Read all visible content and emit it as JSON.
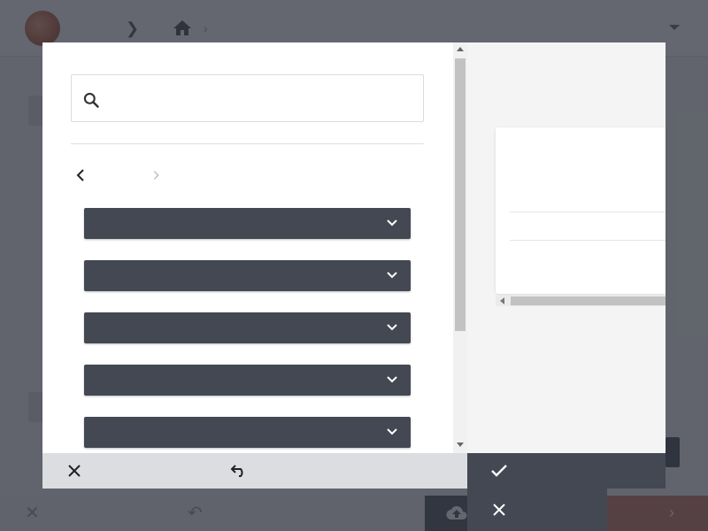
{
  "search": {
    "value": "",
    "placeholder": ""
  },
  "selects": [
    {
      "value": ""
    },
    {
      "value": ""
    },
    {
      "value": ""
    },
    {
      "value": ""
    },
    {
      "value": ""
    }
  ],
  "icons": {
    "search": "search-icon",
    "back": "chevron-left-icon",
    "forward": "chevron-right-icon",
    "dropdown": "chevron-down-icon",
    "close": "close-icon",
    "undo": "undo-icon",
    "confirm": "check-icon",
    "cancel": "close-icon",
    "home": "home-icon",
    "upload": "cloud-upload-icon"
  },
  "colors": {
    "dark": "#434852",
    "overlay": "rgba(40,45,55,0.72)",
    "footer": "#dcdde0",
    "accent_red": "#c97464"
  }
}
